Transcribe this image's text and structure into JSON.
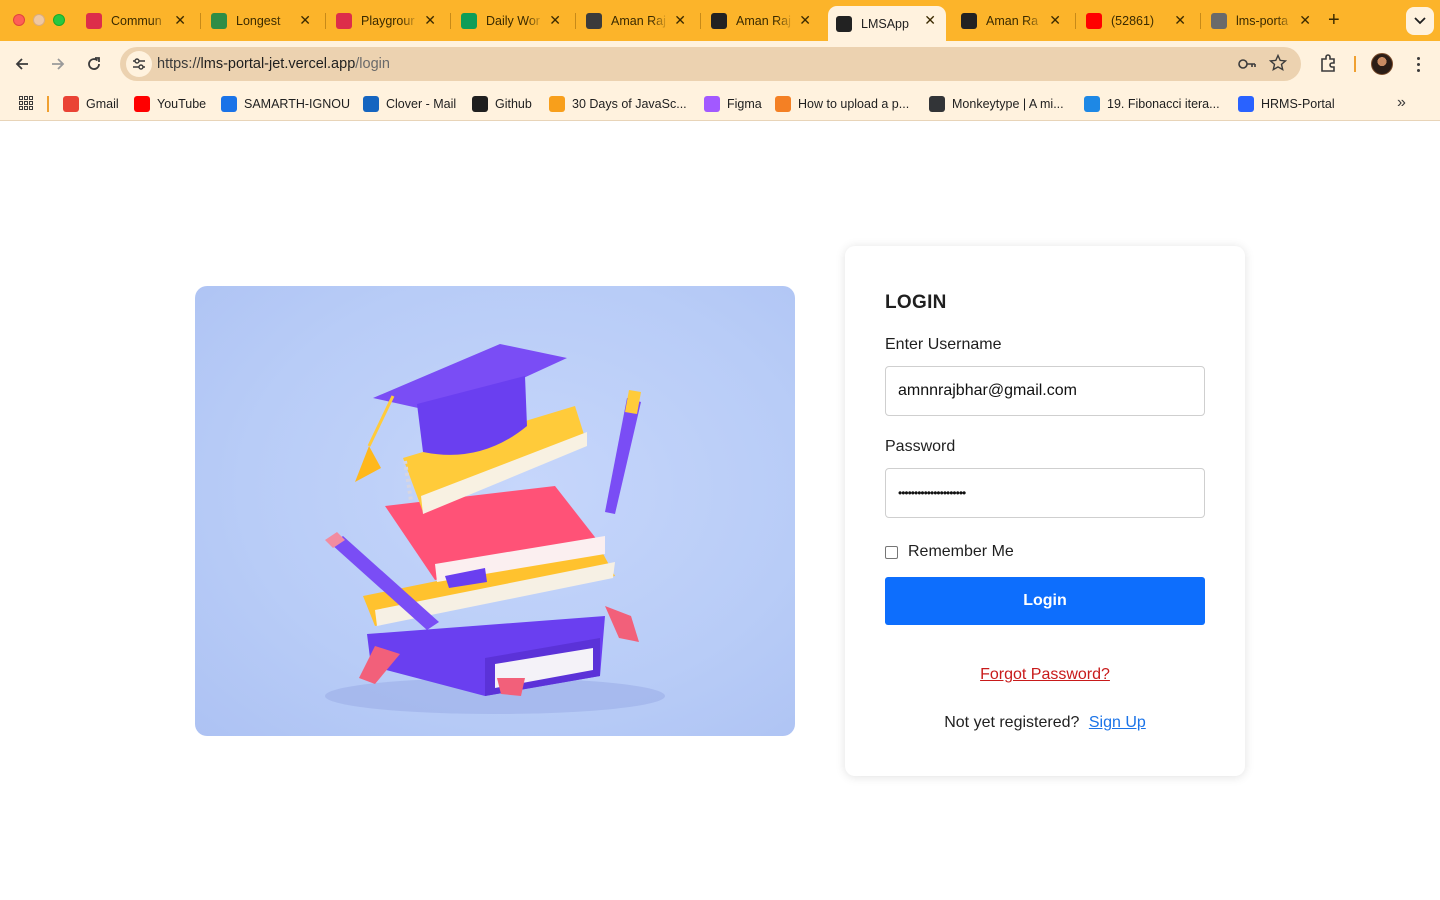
{
  "browser": {
    "tabs": [
      {
        "title": "Commun",
        "icon": "angular-icon",
        "color": "#dd2d4a"
      },
      {
        "title": "Longest",
        "icon": "geeksforgeeks-icon",
        "color": "#2f8d46"
      },
      {
        "title": "Playgrour",
        "icon": "angular-icon",
        "color": "#dd2d4a"
      },
      {
        "title": "Daily Wor",
        "icon": "google-sheets-icon",
        "color": "#0f9d58"
      },
      {
        "title": "Aman Raj",
        "icon": "globe-icon",
        "color": "#3b3b3b"
      },
      {
        "title": "Aman Raj",
        "icon": "avatar-icon",
        "color": "#222222"
      },
      {
        "title": "LMSApp",
        "icon": "angular-icon",
        "color": "#222222",
        "active": true
      },
      {
        "title": "Aman Ra",
        "icon": "avatar-icon",
        "color": "#222222"
      },
      {
        "title": "(52861)",
        "icon": "youtube-icon",
        "color": "#ff0000"
      },
      {
        "title": "lms-porta",
        "icon": "globe-icon",
        "color": "#6a6a6a"
      }
    ],
    "url_scheme": "https://",
    "url_host": "lms-portal-jet.vercel.app",
    "url_path": "/login",
    "bookmarks": [
      {
        "label": "Gmail",
        "icon": "gmail-icon",
        "color": "#ea4335"
      },
      {
        "label": "YouTube",
        "icon": "youtube-icon",
        "color": "#ff0000"
      },
      {
        "label": "SAMARTH-IGNOU",
        "icon": "samarth-icon",
        "color": "#1a73e8"
      },
      {
        "label": "Clover - Mail",
        "icon": "clover-icon",
        "color": "#1565c0"
      },
      {
        "label": "Github",
        "icon": "github-icon",
        "color": "#1f1f1f"
      },
      {
        "label": "30 Days of JavaSc...",
        "icon": "leetcode-icon",
        "color": "#f89f1b"
      },
      {
        "label": "Figma",
        "icon": "figma-icon",
        "color": "#a259ff"
      },
      {
        "label": "How to upload a p...",
        "icon": "stackoverflow-icon",
        "color": "#f48024"
      },
      {
        "label": "Monkeytype | A mi...",
        "icon": "monkeytype-icon",
        "color": "#323437"
      },
      {
        "label": "19. Fibonacci itera...",
        "icon": "video-icon",
        "color": "#1e88e5"
      },
      {
        "label": "HRMS-Portal",
        "icon": "bolt-icon",
        "color": "#2962ff"
      }
    ]
  },
  "login": {
    "title": "LOGIN",
    "username_label": "Enter Username",
    "username_value": "amnnrajbhar@gmail.com",
    "password_label": "Password",
    "password_value": "•••••••••••••••••••••",
    "remember_label": "Remember Me",
    "login_button": "Login",
    "forgot_link": "Forgot Password?",
    "register_text": "Not yet registered?",
    "signup_link": "Sign Up"
  },
  "colors": {
    "tab_strip": "#fcb42a",
    "toolbar": "#fff2de",
    "primary": "#0d6efd",
    "forgot_link": "#c81a1a",
    "signup_link": "#1a73e8",
    "hero_bg": "#b8ccf7"
  }
}
